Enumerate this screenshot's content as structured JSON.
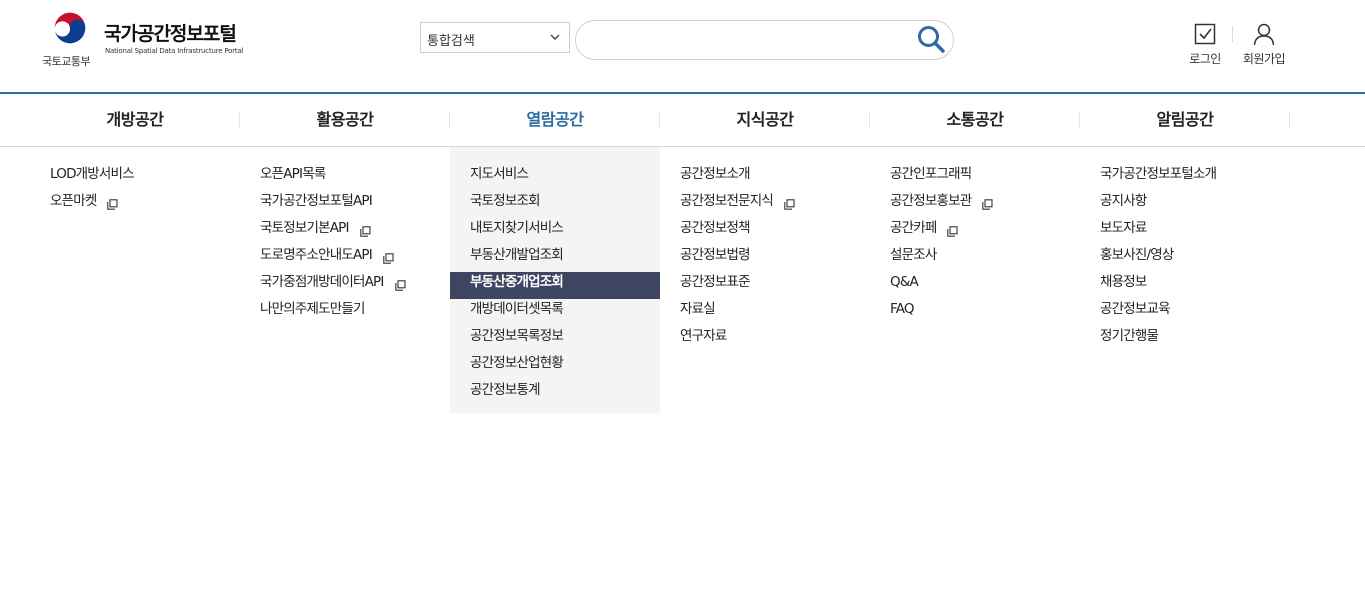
{
  "brand": {
    "ministry": "국토교통부",
    "portal_name": "국가공간정보포털",
    "portal_en": "National Spatial Data Infrastructure Portal",
    "colors": {
      "red": "#c8102e",
      "blue": "#0b3d91",
      "accent": "#2b6aa3",
      "highlight": "#3e4560"
    }
  },
  "search": {
    "scope_value": "통합검색",
    "query": "",
    "placeholder": ""
  },
  "util": {
    "login_label": "로그인",
    "join_label": "회원가입"
  },
  "gnb": [
    {
      "label": "개방공간",
      "active": false
    },
    {
      "label": "활용공간",
      "active": false
    },
    {
      "label": "열람공간",
      "active": true
    },
    {
      "label": "지식공간",
      "active": false
    },
    {
      "label": "소통공간",
      "active": false
    },
    {
      "label": "알림공간",
      "active": false
    }
  ],
  "menu": {
    "col1": [
      {
        "label": "LOD개방서비스",
        "external": false
      },
      {
        "label": "오픈마켓",
        "external": true
      }
    ],
    "col2": [
      {
        "label": "오픈API목록",
        "external": false
      },
      {
        "label": "국가공간정보포털API",
        "external": false
      },
      {
        "label": "국토정보기본API",
        "external": true
      },
      {
        "label": "도로명주소안내도API",
        "external": true
      },
      {
        "label": "국가중점개방데이터API",
        "external": true
      },
      {
        "label": "나만의주제도만들기",
        "external": false
      }
    ],
    "col3": [
      {
        "label": "지도서비스",
        "external": false
      },
      {
        "label": "국토정보조회",
        "external": false
      },
      {
        "label": "내토지찾기서비스",
        "external": false
      },
      {
        "label": "부동산개발업조회",
        "external": false
      },
      {
        "label": "부동산중개업조회",
        "external": false,
        "highlighted": true
      },
      {
        "label": "개방데이터셋목록",
        "external": false
      },
      {
        "label": "공간정보목록정보",
        "external": false
      },
      {
        "label": "공간정보산업현황",
        "external": false
      },
      {
        "label": "공간정보통계",
        "external": false
      }
    ],
    "col4": [
      {
        "label": "공간정보소개",
        "external": false
      },
      {
        "label": "공간정보전문지식",
        "external": true
      },
      {
        "label": "공간정보정책",
        "external": false
      },
      {
        "label": "공간정보법령",
        "external": false
      },
      {
        "label": "공간정보표준",
        "external": false
      },
      {
        "label": "자료실",
        "external": false
      },
      {
        "label": "연구자료",
        "external": false
      }
    ],
    "col5": [
      {
        "label": "공간인포그래픽",
        "external": false
      },
      {
        "label": "공간정보홍보관",
        "external": true
      },
      {
        "label": "공간카페",
        "external": true
      },
      {
        "label": "설문조사",
        "external": false
      },
      {
        "label": "Q&A",
        "external": false
      },
      {
        "label": "FAQ",
        "external": false
      }
    ],
    "col6": [
      {
        "label": "국가공간정보포털소개",
        "external": false
      },
      {
        "label": "공지사항",
        "external": false
      },
      {
        "label": "보도자료",
        "external": false
      },
      {
        "label": "홍보사진/영상",
        "external": false
      },
      {
        "label": "채용정보",
        "external": false
      },
      {
        "label": "공간정보교육",
        "external": false
      },
      {
        "label": "정기간행물",
        "external": false
      }
    ]
  }
}
